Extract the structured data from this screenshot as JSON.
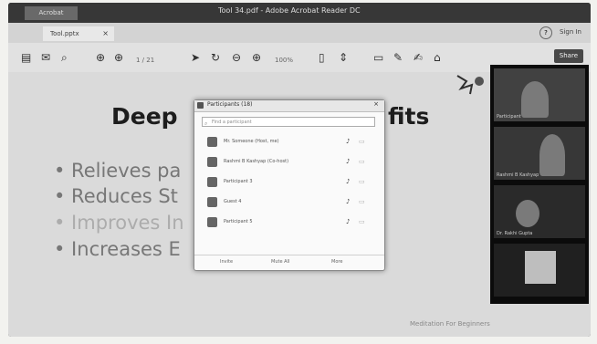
{
  "window": {
    "app_tab": "Acrobat",
    "title": "Tool 34.pdf - Adobe Acrobat Reader DC"
  },
  "tabs": {
    "doc_tab": "Tool.pptx",
    "close": "×",
    "help": "?",
    "sign_in": "Sign In"
  },
  "toolbar": {
    "icons": [
      "save-icon",
      "mail-icon",
      "search-icon",
      "page-up-icon",
      "page-down-icon",
      "cursor-icon",
      "hand-icon",
      "zoom-out-icon",
      "zoom-in-icon",
      "page-fit-icon",
      "scroll-icon",
      "comment-icon",
      "pen-icon",
      "sign-icon",
      "stamp-icon"
    ],
    "page_text": "1 / 21",
    "zoom_text": "100%",
    "share": "Share"
  },
  "slide": {
    "title_left": "Deep",
    "title_right": "fits",
    "bullets": [
      "• Relieves pa",
      "• Reduces St",
      "• Improves In",
      "• Increases E"
    ]
  },
  "participants": {
    "title": "Participants (18)",
    "close": "×",
    "search_placeholder": "Find a participant",
    "rows": [
      {
        "name": "Mr. Someone (Host, me)"
      },
      {
        "name": "Rashmi B Kashyap (Co-host)"
      },
      {
        "name": "Participant 3"
      },
      {
        "name": "Guest 4"
      },
      {
        "name": "Participant 5"
      }
    ],
    "footer": {
      "invite": "Invite",
      "mute_all": "Mute All",
      "more": "More"
    }
  },
  "videos": {
    "tiles": [
      {
        "label": "Participant"
      },
      {
        "label": "Rashmi B Kashyap"
      },
      {
        "label": "Dr. Rakhi Gupta"
      },
      {
        "label": ""
      }
    ]
  },
  "footer_text": "Meditation For Beginners"
}
